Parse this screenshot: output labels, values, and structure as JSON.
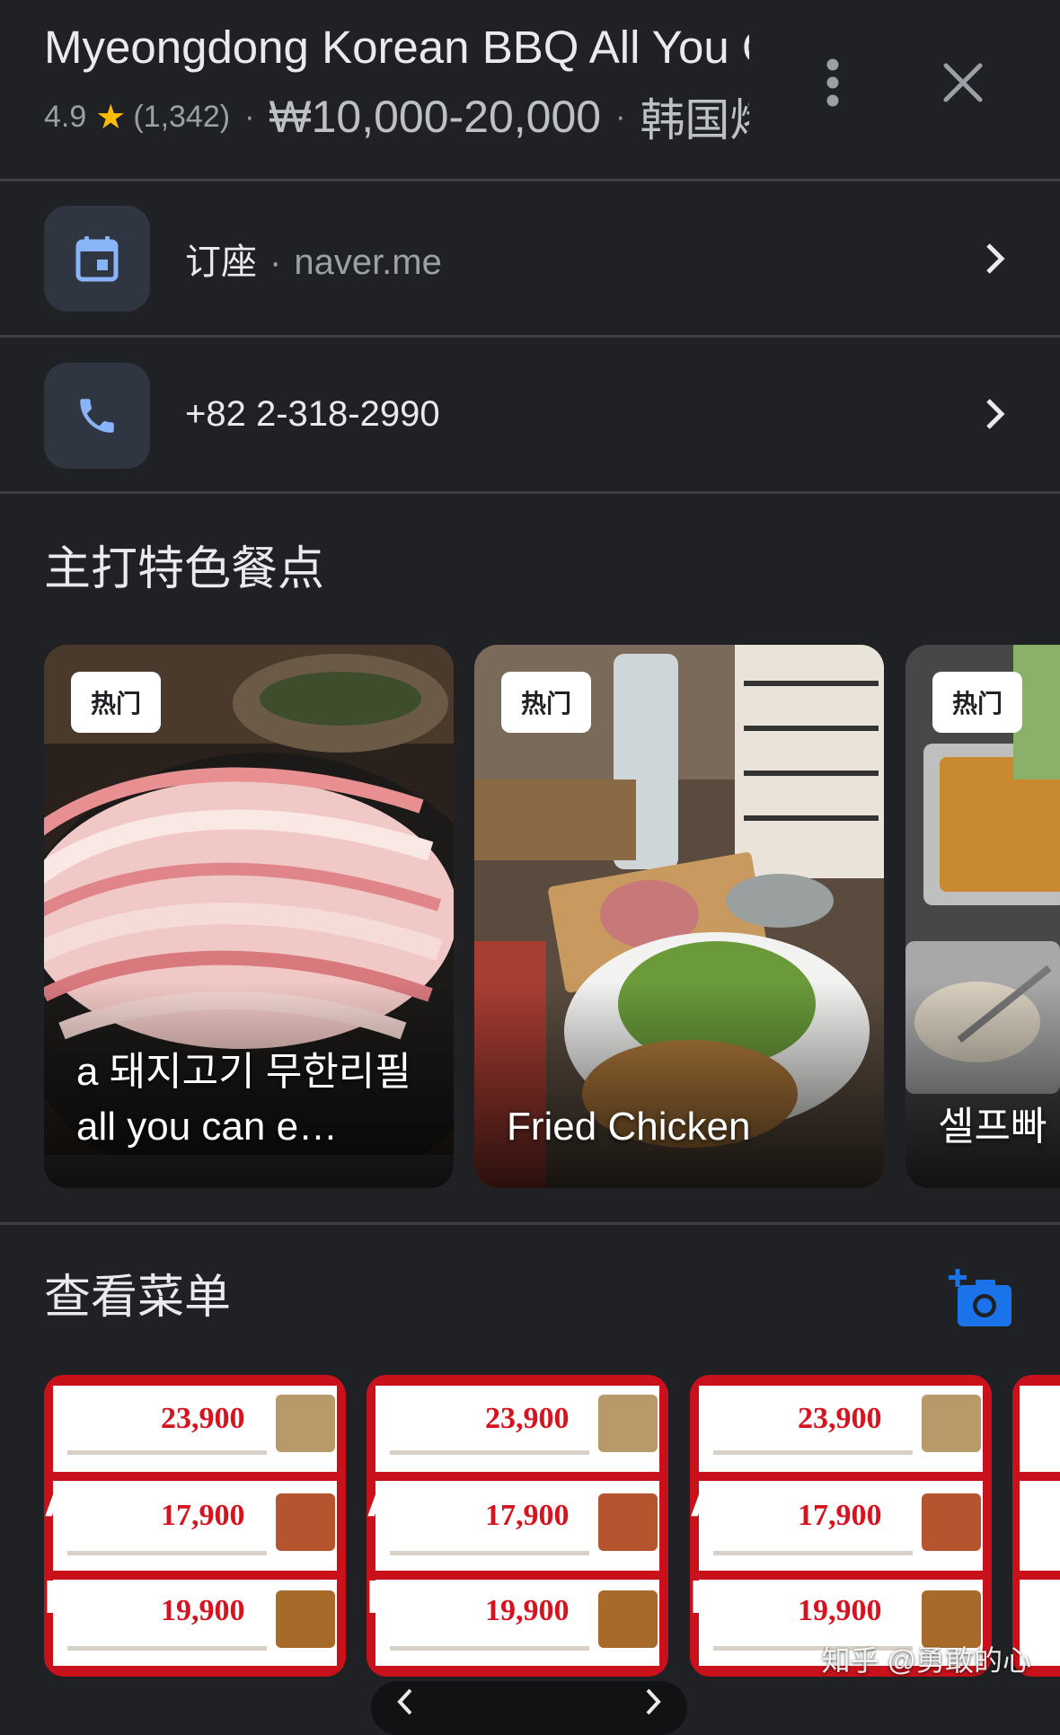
{
  "header": {
    "title": "Myeongdong Korean BBQ All You Can Eat",
    "rating": "4.9",
    "review_count": "(1,342)",
    "separator": "·",
    "price_range": "₩10,000-20,000",
    "cuisine": "韩国烤肉"
  },
  "actions": [
    {
      "label": "订座",
      "separator": "·",
      "sub": "naver.me",
      "icon": "calendar-icon"
    },
    {
      "label": "+82 2-318-2990",
      "icon": "phone-icon"
    }
  ],
  "featured": {
    "title": "主打特色餐点",
    "items": [
      {
        "badge": "热门",
        "caption": "a 돼지고기 무한리필 all you can e…"
      },
      {
        "badge": "热门",
        "caption": "Fried Chicken"
      },
      {
        "badge": "热门",
        "caption": "셀프빠"
      }
    ]
  },
  "menu": {
    "title": "查看菜单",
    "add_photo_icon": "add-photo-icon",
    "images": [
      {
        "prices": [
          "23,900",
          "17,900",
          "19,900"
        ]
      },
      {
        "prices": [
          "23,900",
          "17,900",
          "19,900"
        ]
      },
      {
        "prices": [
          "23,900",
          "17,900",
          "19,900"
        ]
      }
    ]
  },
  "watermark": "知乎 @勇敢的心",
  "colors": {
    "background": "#202124",
    "accent": "#1a73e8",
    "icon_blue": "#8ab4f8",
    "star": "#fbbc04"
  }
}
